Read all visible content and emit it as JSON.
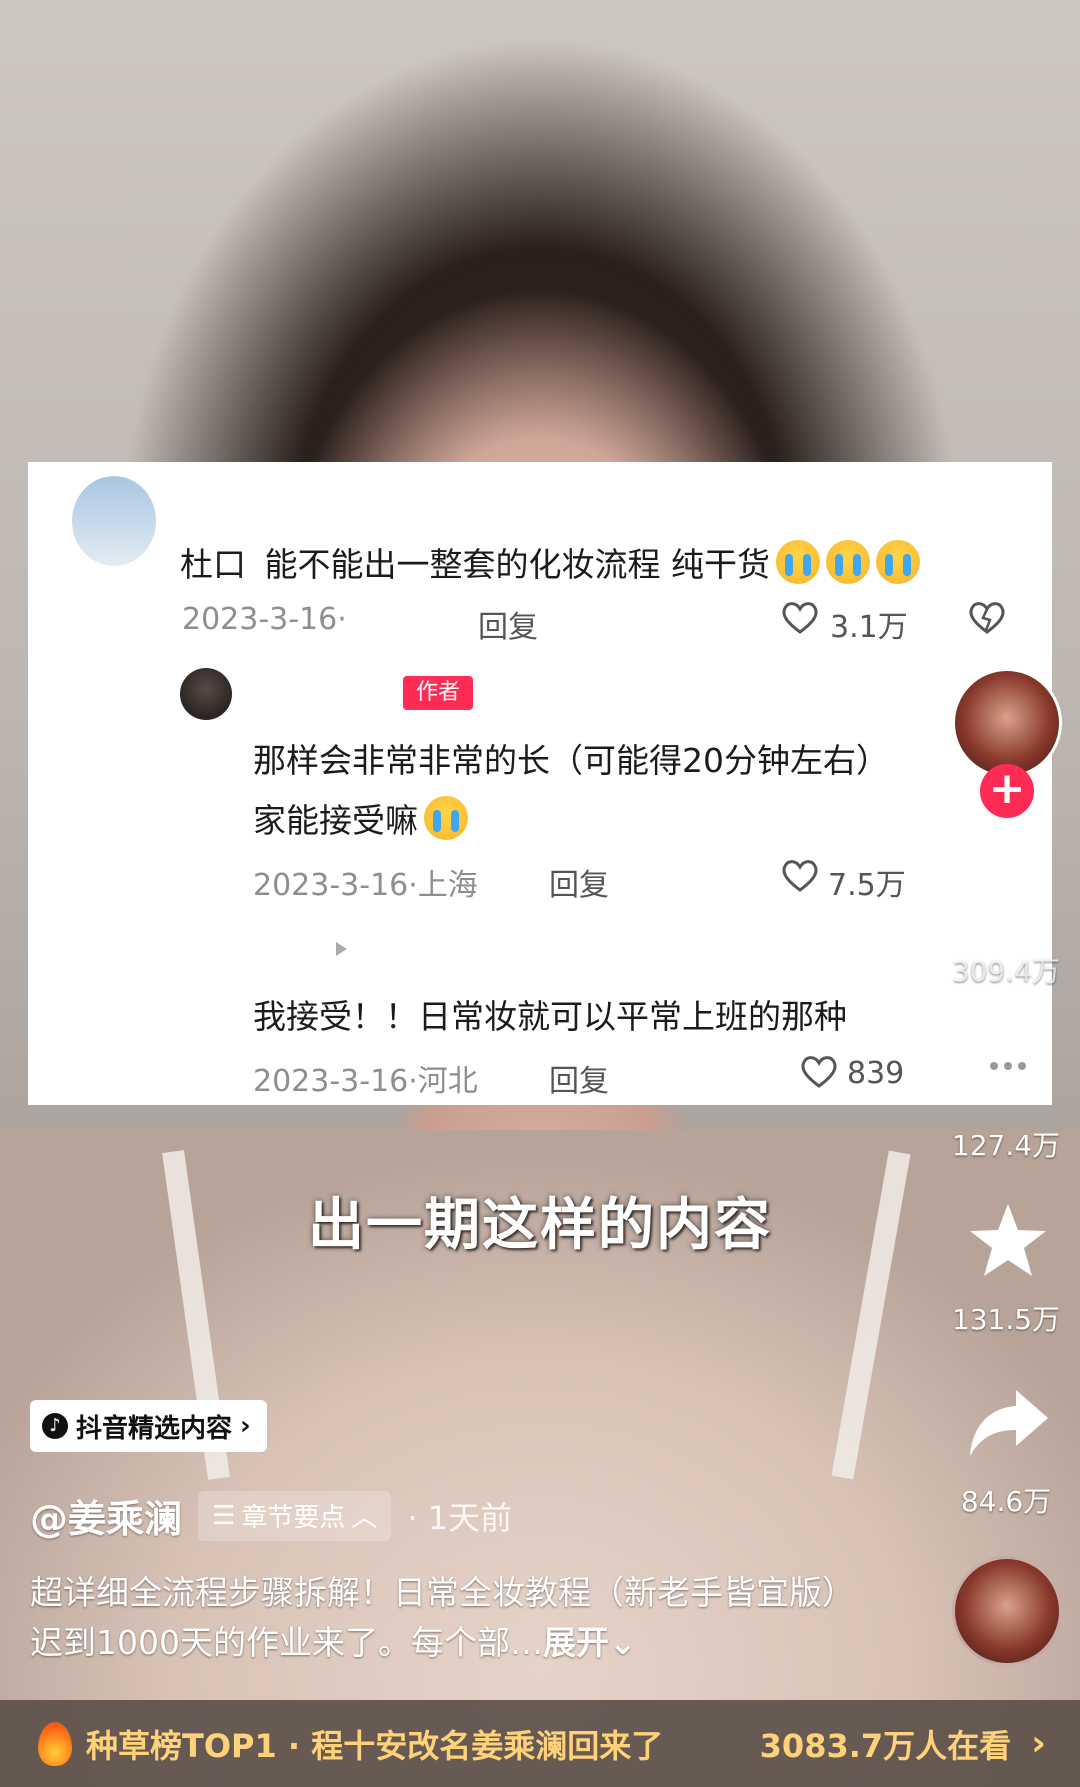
{
  "comment_panel": {
    "top_comment": {
      "user_fragment": "杜口",
      "text": "能不能出一整套的化妆流程 纯干货",
      "date": "2023-3-16·",
      "reply_label": "回复",
      "likes": "3.1万"
    },
    "author_reply": {
      "badge": "作者",
      "text_line1": "那样会非常非常的长（可能得20分钟左右）",
      "text_line2": "家能接受嘛",
      "meta": "2023-3-16·上海",
      "reply_label": "回复",
      "likes": "7.5万"
    },
    "third_comment": {
      "text": "我接受！！日常妆就可以平常上班的那种",
      "meta": "2023-3-16·河北",
      "reply_label": "回复",
      "likes": "839"
    }
  },
  "video": {
    "subtitle": "出一期这样的内容"
  },
  "right_rail": {
    "like_count": "309.4万",
    "comment_count": "127.4万",
    "favorite_count": "131.5万",
    "share_count": "84.6万",
    "follow_symbol": "+"
  },
  "tag_chip": "抖音精选内容",
  "author": {
    "name": "@姜乘澜",
    "chapter_label": "章节要点",
    "time": "· 1天前"
  },
  "description": {
    "text": "超详细全流程步骤拆解！日常全妆教程（新老手皆宜版） 迟到1000天的作业来了。每个部…",
    "expand": "展开"
  },
  "hot_bar": {
    "title": "种草榜TOP1 · 程十安改名姜乘澜回来了",
    "viewers": "3083.7万人在看",
    "arrow": "›"
  },
  "colors": {
    "accent_red": "#fe2c55",
    "hot_text": "#ffd27a"
  }
}
